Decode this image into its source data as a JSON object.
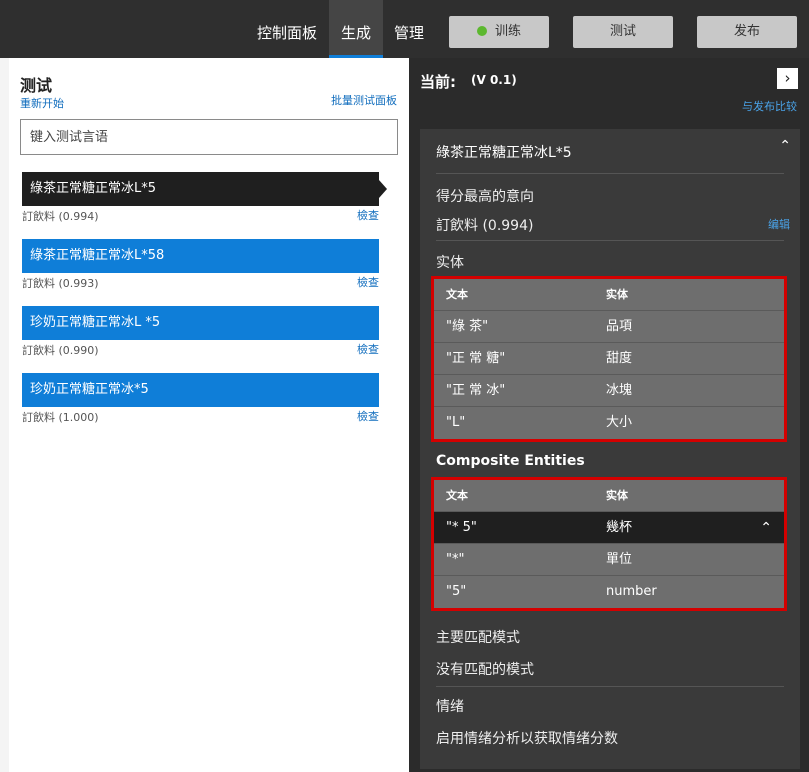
{
  "topnav": {
    "items": [
      "控制面板",
      "生成",
      "管理"
    ],
    "active": "生成",
    "train_label": "训练",
    "test_label": "测试",
    "publish_label": "发布",
    "train_status_color": "#5cb82f"
  },
  "test_panel": {
    "title": "测试",
    "restart_label": "重新开始",
    "batch_label": "批量测试面板",
    "input_placeholder": "键入测试言语",
    "utterances": [
      {
        "text": "綠茶正常糖正常冰L*5",
        "intent": "訂飲料 (0.994)",
        "inspect": "檢查"
      },
      {
        "text": "綠茶正常糖正常冰L*58",
        "intent": "訂飲料 (0.993)",
        "inspect": "檢查"
      },
      {
        "text": "珍奶正常糖正常冰L *5",
        "intent": "訂飲料 (0.990)",
        "inspect": "檢查"
      },
      {
        "text": "珍奶正常糖正常冰*5",
        "intent": "訂飲料 (1.000)",
        "inspect": "檢查"
      }
    ]
  },
  "inspect": {
    "current_label": "当前:",
    "version": "(V 0.1)",
    "compare_label": "与发布比较",
    "utterance": "綠茶正常糖正常冰L*5",
    "top_intent_label": "得分最高的意向",
    "top_intent_value": "訂飲料 (0.994)",
    "edit_label": "编辑",
    "entities_label": "实体",
    "entities_header": {
      "text": "文本",
      "entity": "实体"
    },
    "entities": [
      {
        "text": "\"綠 茶\"",
        "entity": "品項"
      },
      {
        "text": "\"正 常 糖\"",
        "entity": "甜度"
      },
      {
        "text": "\"正 常 冰\"",
        "entity": "冰塊"
      },
      {
        "text": "\"L\"",
        "entity": "大小"
      }
    ],
    "composite_label": "Composite Entities",
    "composite_header": {
      "text": "文本",
      "entity": "实体"
    },
    "composite_parent": {
      "text": "\"* 5\"",
      "entity": "幾杯"
    },
    "composite_children": [
      {
        "text": "\"*\"",
        "entity": "單位"
      },
      {
        "text": "\"5\"",
        "entity": "number"
      }
    ],
    "pattern_label": "主要匹配模式",
    "pattern_value": "没有匹配的模式",
    "sentiment_label": "情绪",
    "sentiment_value": "启用情绪分析以获取情绪分数"
  }
}
